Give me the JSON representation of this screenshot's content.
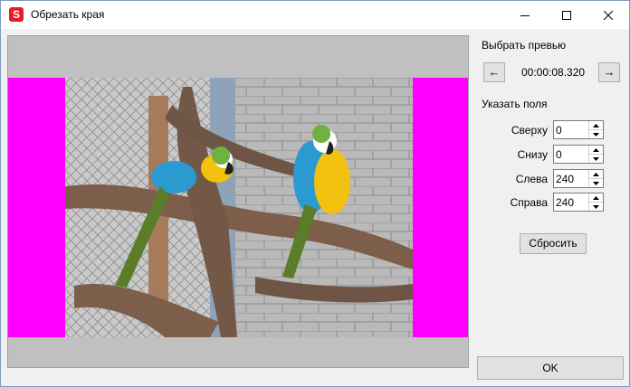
{
  "window": {
    "title": "Обрезать края",
    "app_icon_letter": "S",
    "controls": [
      "minimize-icon",
      "maximize-icon",
      "close-icon"
    ]
  },
  "preview": {
    "border_color": "#ff00ff",
    "image_description": "two blue-and-yellow macaws perched on branches"
  },
  "side": {
    "choose_preview_label": "Выбрать превью",
    "prev_button": "←",
    "next_button": "→",
    "timestamp": "00:00:08.320",
    "margins_label": "Указать поля",
    "fields": [
      {
        "label": "Сверху",
        "value": "0"
      },
      {
        "label": "Снизу",
        "value": "0"
      },
      {
        "label": "Слева",
        "value": "240"
      },
      {
        "label": "Справа",
        "value": "240"
      }
    ],
    "reset_button": "Сбросить",
    "ok_button": "OK"
  }
}
